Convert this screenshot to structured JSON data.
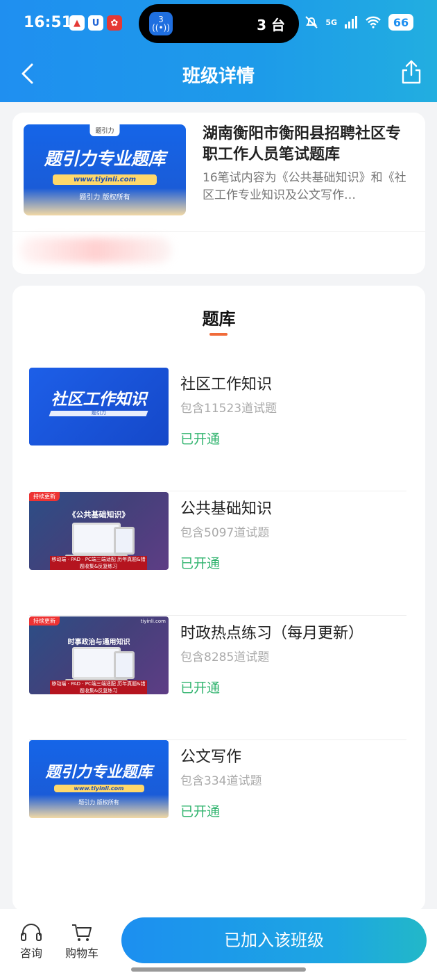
{
  "status_bar": {
    "time": "16:51",
    "island_badge": "3",
    "island_text": "3 台",
    "network": "5G",
    "battery": "66"
  },
  "nav": {
    "title": "班级详情"
  },
  "class_info": {
    "cover_title": "题引力专业题库",
    "cover_url": "www.tiyinli.com",
    "cover_copyright": "题引力 版权所有",
    "cover_logo": "题引力",
    "title": "湖南衡阳市衡阳县招聘社区专职工作人员笔试题库",
    "description": "16笔试内容为《公共基础知识》和《社区工作专业知识及公文写作…"
  },
  "bank": {
    "section_title": "题库",
    "items": [
      {
        "name": "社区工作知识",
        "count": "包含11523道试题",
        "status": "已开通",
        "thumb_title": "社区工作知识",
        "thumb_sub": "题引力"
      },
      {
        "name": "公共基础知识",
        "count": "包含5097道试题",
        "status": "已开通",
        "thumb_tag": "持续更新",
        "thumb_title": "《公共基础知识》",
        "thumb_band": "移动端 · PAD · PC端三端适配 历年真题&错题收集&反复练习"
      },
      {
        "name": "时政热点练习（每月更新）",
        "count": "包含8285道试题",
        "status": "已开通",
        "thumb_tag": "持续更新",
        "thumb_title": "时事政治与通用知识",
        "thumb_site": "tiyinli.com",
        "thumb_band": "移动端 · PAD · PC端三端适配 历年真题&错题收集&反复练习"
      },
      {
        "name": "公文写作",
        "count": "包含334道试题",
        "status": "已开通",
        "thumb_title": "题引力专业题库",
        "thumb_url": "www.tiyinli.com",
        "thumb_copy": "题引力 版权所有"
      }
    ]
  },
  "bottom_bar": {
    "consult_label": "咨询",
    "cart_label": "购物车",
    "join_label": "已加入该班级"
  }
}
